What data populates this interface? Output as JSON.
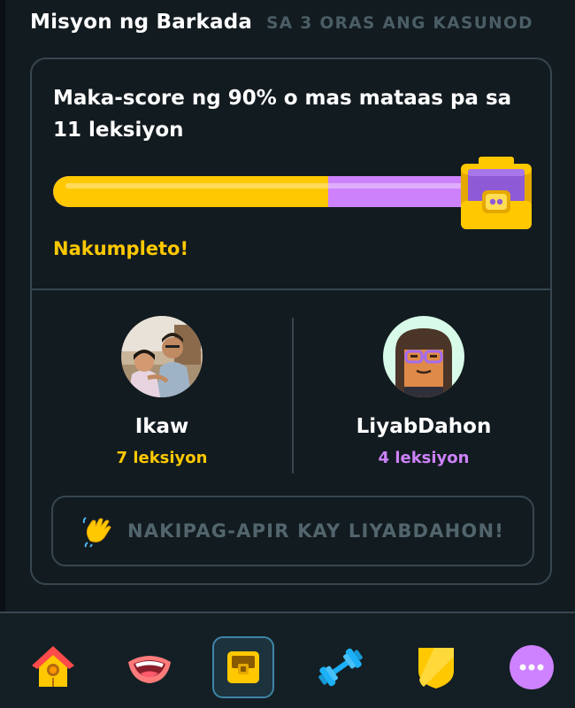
{
  "header": {
    "title": "Misyon ng Barkada",
    "timer": "SA 3 ORAS ANG KASUNOD"
  },
  "quest": {
    "goal": "Maka-score ng 90% o mas mataas pa sa 11 leksiyon",
    "progress_fraction": 0.64,
    "status": "Nakumpleto!",
    "colors": {
      "yours": "#ffc800",
      "friend": "#cd82fb"
    }
  },
  "players": [
    {
      "name": "Ikaw",
      "lessons": "7 leksiyon",
      "avatar": "photo-avatar"
    },
    {
      "name": "LiyabDahon",
      "lessons": "4 leksiyon",
      "avatar": "character-avatar"
    }
  ],
  "high_five": {
    "label": "NAKIPAG-APIR KAY LIYABDAHON!",
    "icon": "waving-hand-icon"
  },
  "navbar": {
    "items": [
      {
        "icon": "home-icon",
        "active": false
      },
      {
        "icon": "speaking-mouth-icon",
        "active": false
      },
      {
        "icon": "treasure-chest-icon",
        "active": true
      },
      {
        "icon": "dumbbell-icon",
        "active": false
      },
      {
        "icon": "shield-icon",
        "active": false
      },
      {
        "icon": "more-icon",
        "active": false
      }
    ]
  }
}
